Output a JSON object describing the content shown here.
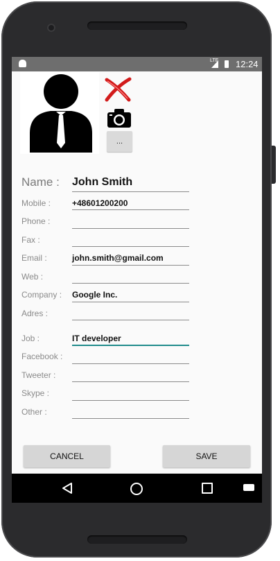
{
  "status_bar": {
    "network": "LTE",
    "time": "12:24"
  },
  "contact": {
    "more_button": "...",
    "name": {
      "label": "Name :",
      "value": "John Smith"
    },
    "fields": [
      {
        "key": "mobile",
        "label": "Mobile :",
        "value": "+48601200200"
      },
      {
        "key": "phone",
        "label": "Phone :",
        "value": ""
      },
      {
        "key": "fax",
        "label": "Fax :",
        "value": ""
      },
      {
        "key": "email",
        "label": "Email :",
        "value": "john.smith@gmail.com"
      },
      {
        "key": "web",
        "label": "Web :",
        "value": ""
      },
      {
        "key": "company",
        "label": "Company :",
        "value": "Google Inc."
      },
      {
        "key": "address",
        "label": "Adres :",
        "value": ""
      },
      {
        "key": "job",
        "label": "Job :",
        "value": "IT developer"
      },
      {
        "key": "facebook",
        "label": "Facebook :",
        "value": ""
      },
      {
        "key": "twitter",
        "label": "Tweeter :",
        "value": ""
      },
      {
        "key": "skype",
        "label": "Skype :",
        "value": ""
      },
      {
        "key": "other",
        "label": "Other :",
        "value": ""
      }
    ]
  },
  "actions": {
    "cancel": "CANCEL",
    "save": "SAVE"
  },
  "colors": {
    "accent": "#1e8a8a",
    "delete": "#d21b1b",
    "statusbar": "#6e6e6e",
    "navbar": "#000000"
  }
}
